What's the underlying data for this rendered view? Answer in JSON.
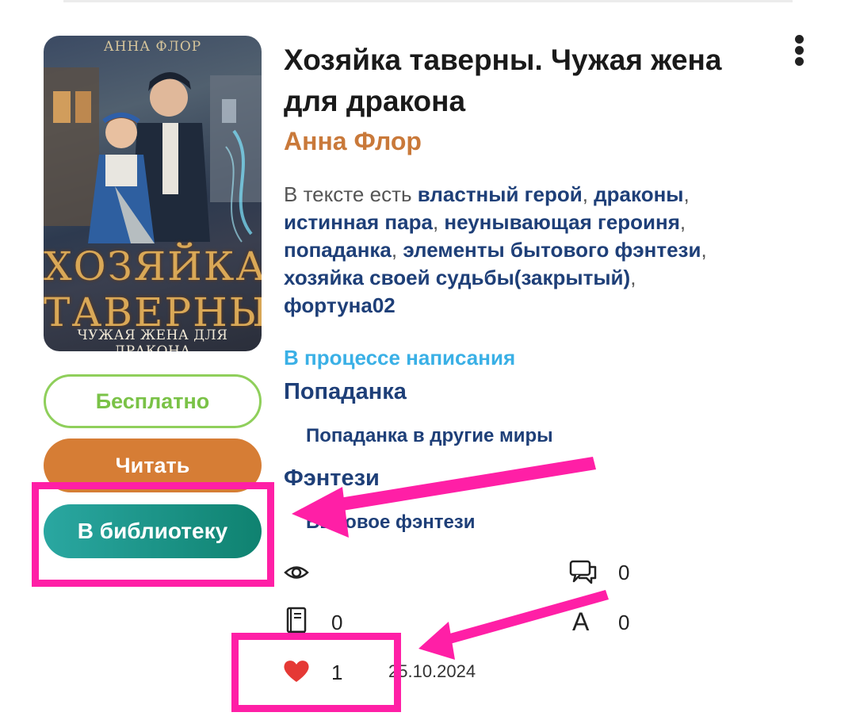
{
  "book": {
    "title": "Хозяйка таверны. Чужая жена для дракона",
    "author": "Анна Флор",
    "tags_prefix": "В тексте есть ",
    "tags": [
      "властный герой",
      "драконы",
      "истинная пара",
      "неунывающая героиня",
      "попаданка",
      "элементы бытового фэнтези",
      "хозяйка своей судьбы(закрытый)",
      "фортуна02"
    ],
    "status": "В процессе написания",
    "genres": [
      {
        "name": "Попаданка",
        "sub": "Попаданка в другие миры"
      },
      {
        "name": "Фэнтези",
        "sub": "Бытовое фэнтези"
      }
    ],
    "date": "25.10.2024"
  },
  "cover": {
    "author": "АННА ФЛОР",
    "title_line1": "ХОЗЯЙКА",
    "title_line2": "ТАВЕРНЫ",
    "subtitle": "ЧУЖАЯ ЖЕНА ДЛЯ ДРАКОНА"
  },
  "buttons": {
    "free": "Бесплатно",
    "read": "Читать",
    "library": "В библиотеку"
  },
  "stats": {
    "views": "",
    "comments": "0",
    "library": "0",
    "awards": "0",
    "likes": "1"
  },
  "icons": [
    "more-vertical-icon",
    "eye-icon",
    "comments-icon",
    "book-icon",
    "font-a-icon",
    "heart-icon"
  ],
  "colors": {
    "accent_orange": "#d67d35",
    "free_green": "#8fcf5b",
    "library_teal": "#1a948a",
    "link_navy": "#1e3f78",
    "status_blue": "#3ab0e6",
    "annotation_pink": "#ff1fa6",
    "heart_red": "#e53935"
  }
}
